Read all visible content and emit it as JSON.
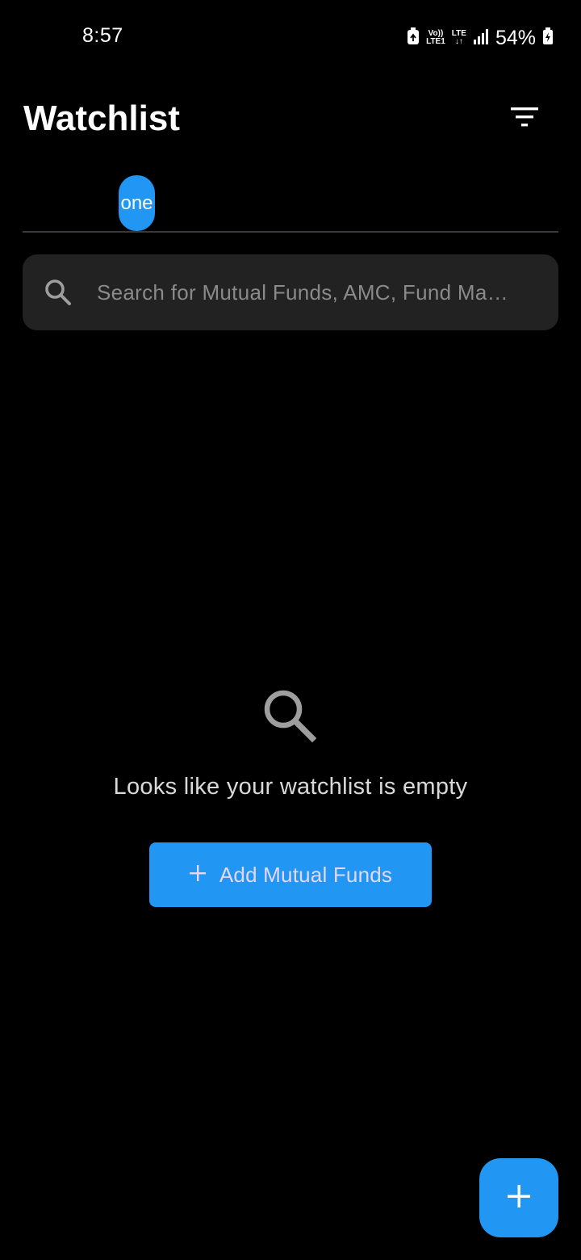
{
  "status_bar": {
    "time": "8:57",
    "volte_line1": "Vo))",
    "volte_line2": "LTE1",
    "lte_label": "LTE",
    "battery_percent": "54%"
  },
  "header": {
    "title": "Watchlist",
    "filter_icon": "filter-icon"
  },
  "tabs": [
    {
      "label": "one",
      "selected": true
    }
  ],
  "search": {
    "placeholder": "Search for Mutual Funds, AMC, Fund Ma…",
    "value": "",
    "icon": "search-icon"
  },
  "empty_state": {
    "icon": "search-icon",
    "message": "Looks like your watchlist is empty",
    "button_label": "Add Mutual Funds",
    "button_icon": "plus-icon"
  },
  "fab": {
    "icon": "plus-icon"
  },
  "colors": {
    "background": "#000000",
    "accent": "#2196f3",
    "search_bg": "#222222",
    "button_text": "#e6d6f7"
  }
}
